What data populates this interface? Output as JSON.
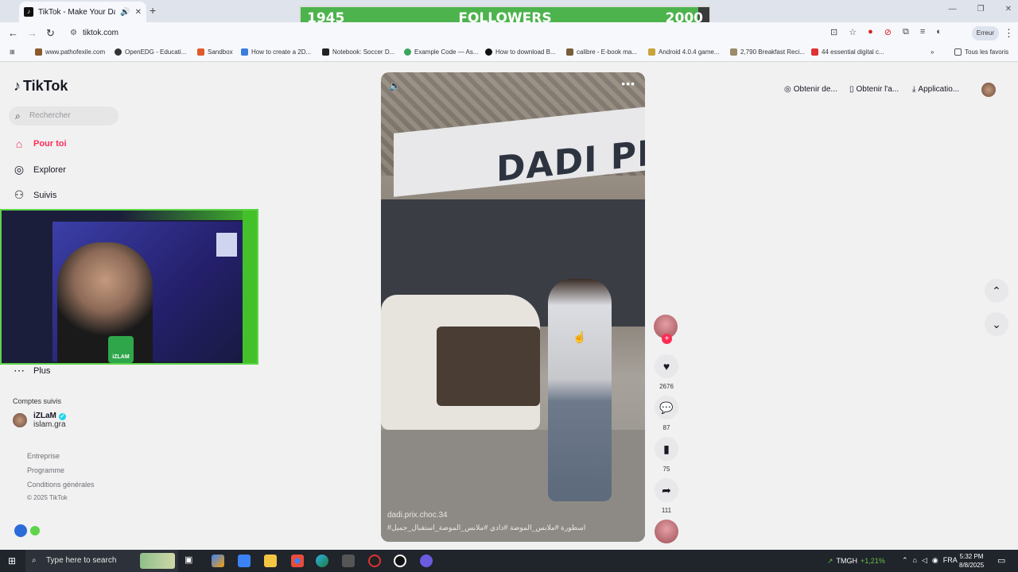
{
  "browser": {
    "tab_title": "TikTok - Make Your Day",
    "url": "tiktok.com",
    "error_button": "Erreur",
    "bookmarks": [
      "www.pathofexile.com",
      "OpenEDG - Educati...",
      "Sandbox",
      "How to create a 2D...",
      "Notebook: Soccer D...",
      "Example Code — As...",
      "How to download B...",
      "calibre - E-book ma...",
      "Android 4.0.4 game...",
      "2,790 Breakfast Reci...",
      "44 essential digital c..."
    ],
    "all_bookmarks": "Tous les favoris"
  },
  "overlay": {
    "followers_current": "1945",
    "followers_label": "FOLLOWERS",
    "followers_goal": "2000",
    "followers_progress": 0.9725
  },
  "tiktok": {
    "logo": "TikTok",
    "search_placeholder": "Rechercher",
    "nav": {
      "for_you": "Pour toi",
      "explore": "Explorer",
      "following": "Suivis",
      "more": "Plus"
    },
    "followed_title": "Comptes suivis",
    "followed_user": {
      "name": "iZLaM",
      "handle": "islam.gra"
    },
    "webcam_badge": "iZLAM",
    "footer": {
      "company": "Entreprise",
      "program": "Programme",
      "terms": "Conditions générales",
      "copyright": "© 2025 TikTok"
    },
    "header": {
      "get_coins": "Obtenir de...",
      "get_app": "Obtenir l'a...",
      "application": "Applicatio..."
    },
    "video": {
      "author": "dadi.prix.choc.34",
      "tags": "#اسطورة #ملابس_الموضة #دادي #ملابس_الموضة_استقبال_جميل",
      "sign_text": "DADI PR"
    },
    "actions": {
      "likes": "2676",
      "comments": "87",
      "saves": "75",
      "shares": "111"
    }
  },
  "taskbar": {
    "search_placeholder": "Type here to search",
    "stock_name": "TMGH",
    "stock_change": "+1,21%",
    "language": "FRA",
    "time": "5:32 PM",
    "date": "8/8/2025"
  },
  "colors": {
    "accent": "#fe2c55",
    "progress_green": "#4db34d",
    "webcam_border": "#5ed44a"
  }
}
